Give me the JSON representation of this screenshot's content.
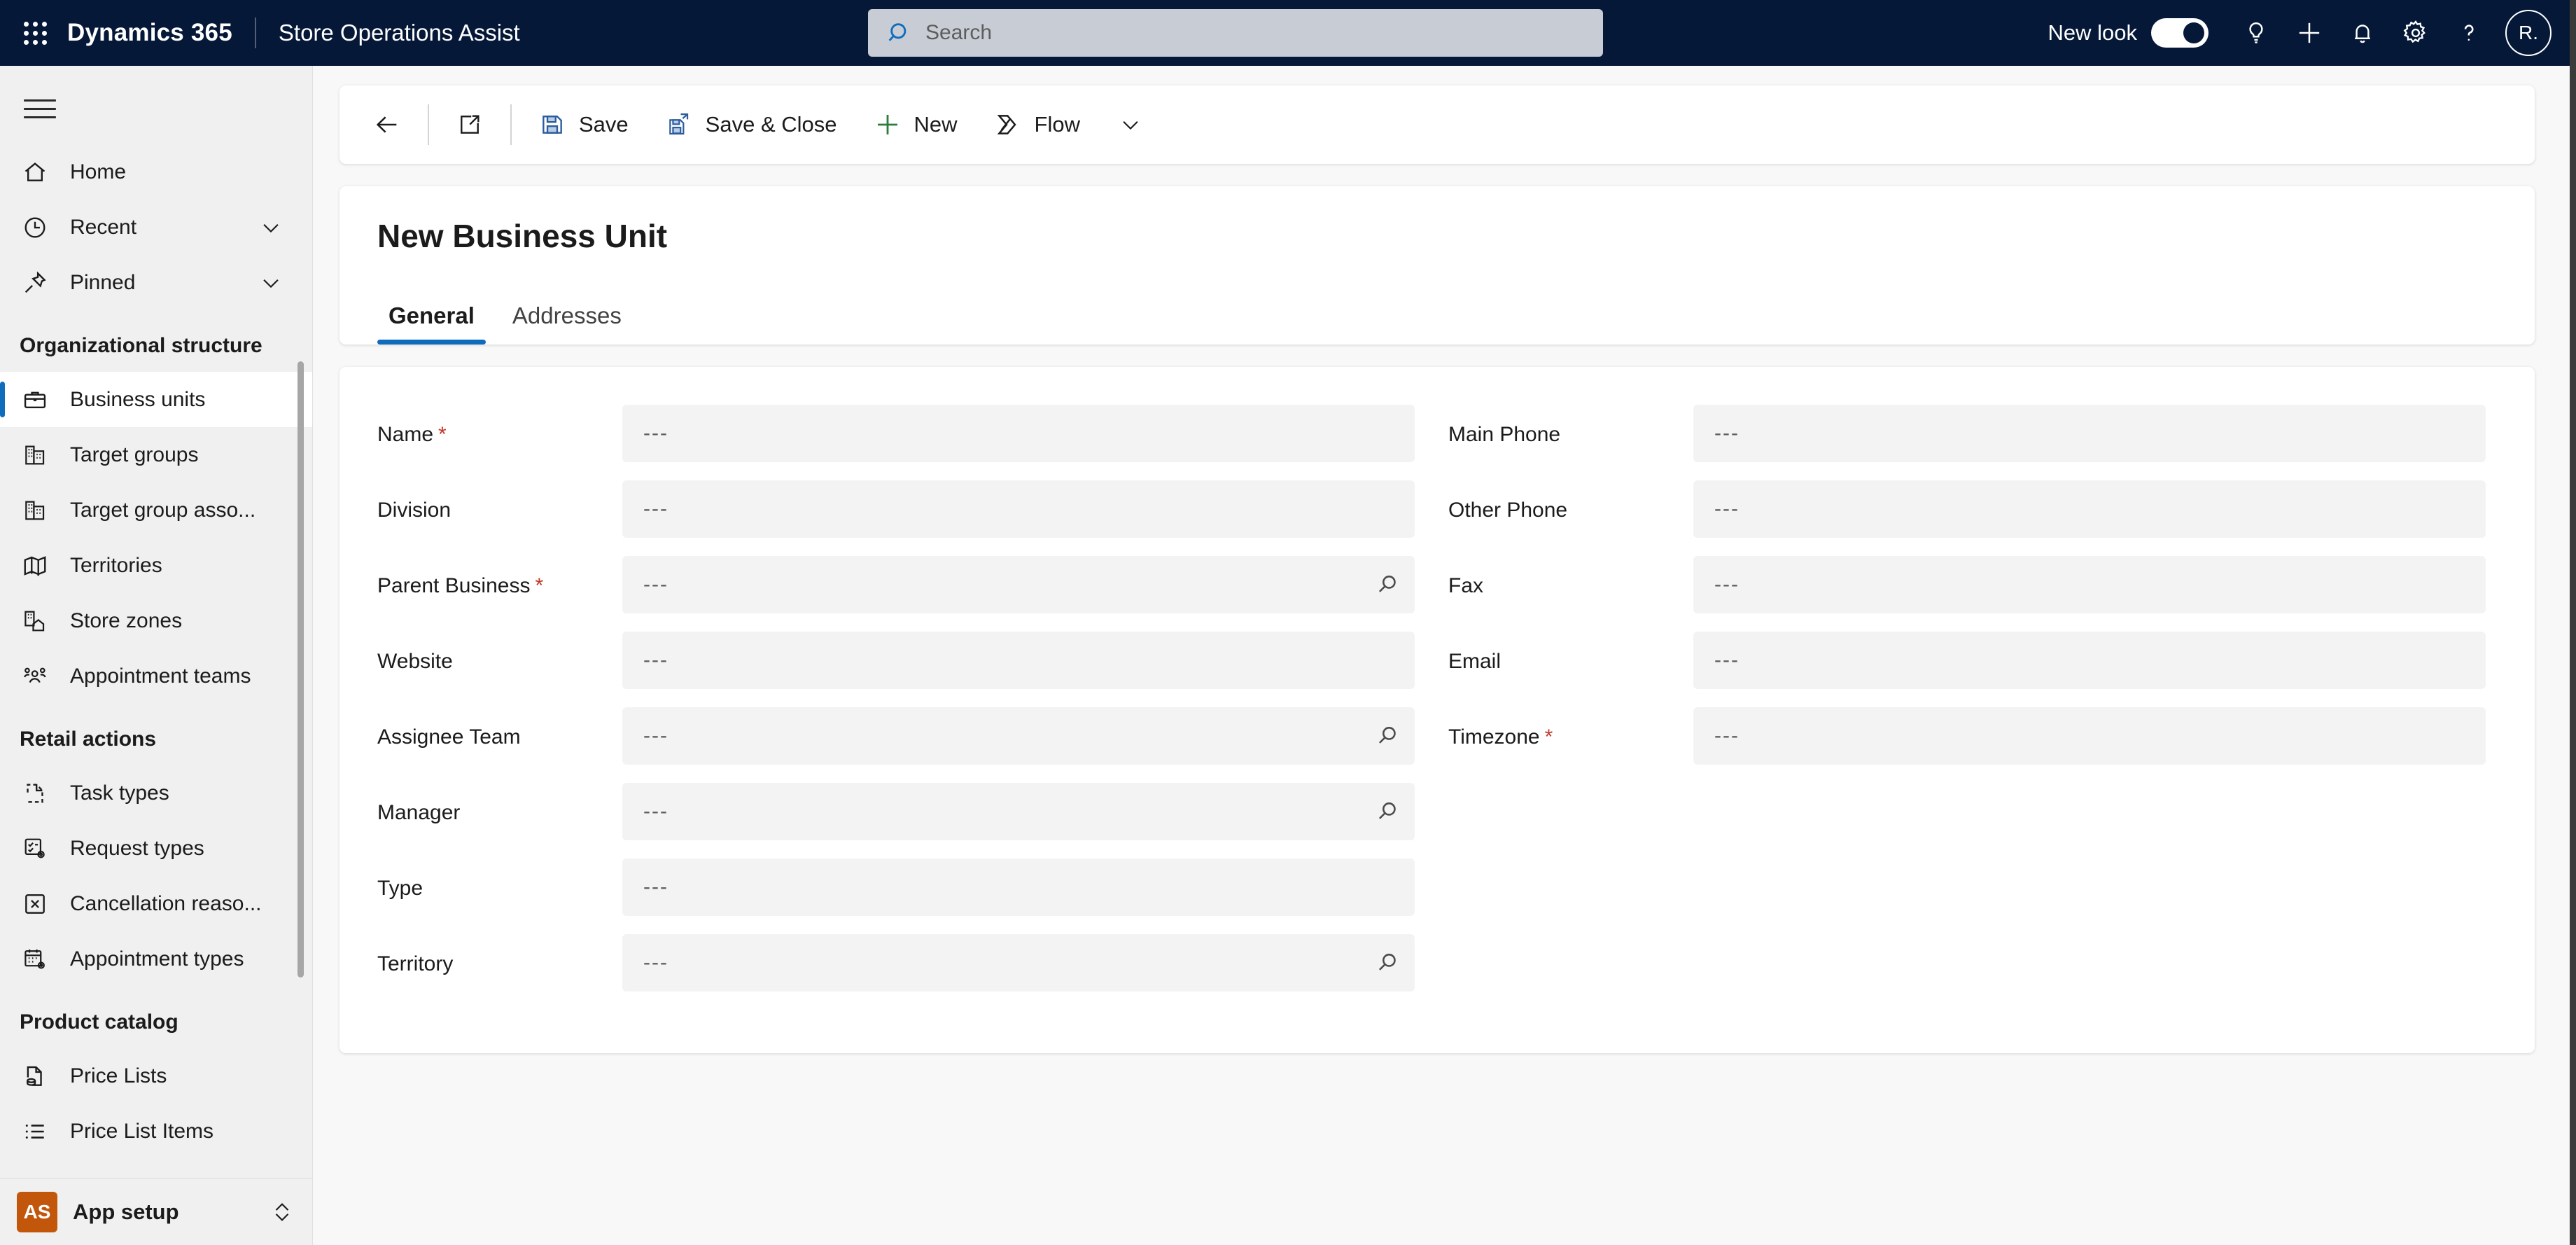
{
  "header": {
    "waffle_icon": "app-launcher-waffle-icon",
    "brand": "Dynamics 365",
    "app_name": "Store Operations Assist",
    "search": {
      "placeholder": "Search",
      "icon": "search-icon"
    },
    "new_look_label": "New look",
    "new_look_on": true,
    "icons": [
      "lightbulb-icon",
      "plus-icon",
      "bell-icon",
      "gear-icon",
      "question-icon"
    ],
    "avatar_initials": "R."
  },
  "sidebar": {
    "hamburger_icon": "hamburger-menu-icon",
    "items": [
      {
        "label": "Home",
        "icon": "home-icon",
        "chevron": false,
        "selected": false
      },
      {
        "label": "Recent",
        "icon": "clock-icon",
        "chevron": true,
        "selected": false
      },
      {
        "label": "Pinned",
        "icon": "pin-icon",
        "chevron": true,
        "selected": false
      }
    ],
    "groups": [
      {
        "title": "Organizational structure",
        "items": [
          {
            "label": "Business units",
            "icon": "briefcase-icon",
            "selected": true
          },
          {
            "label": "Target groups",
            "icon": "building-icon",
            "selected": false
          },
          {
            "label": "Target group asso...",
            "icon": "building-icon",
            "selected": false
          },
          {
            "label": "Territories",
            "icon": "map-icon",
            "selected": false
          },
          {
            "label": "Store zones",
            "icon": "store-zone-icon",
            "selected": false
          },
          {
            "label": "Appointment teams",
            "icon": "people-icon",
            "selected": false
          }
        ]
      },
      {
        "title": "Retail actions",
        "items": [
          {
            "label": "Task types",
            "icon": "document-dashed-icon",
            "selected": false
          },
          {
            "label": "Request types",
            "icon": "checklist-gear-icon",
            "selected": false
          },
          {
            "label": "Cancellation reaso...",
            "icon": "box-x-icon",
            "selected": false
          },
          {
            "label": "Appointment types",
            "icon": "calendar-gear-icon",
            "selected": false
          }
        ]
      },
      {
        "title": "Product catalog",
        "items": [
          {
            "label": "Price Lists",
            "icon": "price-list-icon",
            "selected": false
          },
          {
            "label": "Price List Items",
            "icon": "list-icon",
            "selected": false
          }
        ]
      }
    ],
    "app_setup": {
      "badge": "AS",
      "label": "App setup",
      "chevron_icon": "chevron-up-down-icon"
    }
  },
  "command_bar": {
    "back_icon": "back-arrow-icon",
    "popout_icon": "open-in-new-window-icon",
    "buttons": [
      {
        "label": "Save",
        "icon": "save-icon"
      },
      {
        "label": "Save & Close",
        "icon": "save-and-close-icon"
      },
      {
        "label": "New",
        "icon": "plus-icon"
      },
      {
        "label": "Flow",
        "icon": "flow-icon"
      }
    ],
    "overflow_icon": "chevron-down-icon"
  },
  "record": {
    "title": "New Business Unit",
    "tabs": [
      {
        "label": "General",
        "active": true
      },
      {
        "label": "Addresses",
        "active": false
      }
    ]
  },
  "form": {
    "left_column": [
      {
        "label": "Name",
        "required": true,
        "value": "---",
        "lookup": false
      },
      {
        "label": "Division",
        "required": false,
        "value": "---",
        "lookup": false
      },
      {
        "label": "Parent Business",
        "required": true,
        "value": "---",
        "lookup": true
      },
      {
        "label": "Website",
        "required": false,
        "value": "---",
        "lookup": false
      },
      {
        "label": "Assignee Team",
        "required": false,
        "value": "---",
        "lookup": true
      },
      {
        "label": "Manager",
        "required": false,
        "value": "---",
        "lookup": true
      },
      {
        "label": "Type",
        "required": false,
        "value": "---",
        "lookup": false
      },
      {
        "label": "Territory",
        "required": false,
        "value": "---",
        "lookup": true
      }
    ],
    "right_column": [
      {
        "label": "Main Phone",
        "required": false,
        "value": "---",
        "lookup": false
      },
      {
        "label": "Other Phone",
        "required": false,
        "value": "---",
        "lookup": false
      },
      {
        "label": "Fax",
        "required": false,
        "value": "---",
        "lookup": false
      },
      {
        "label": "Email",
        "required": false,
        "value": "---",
        "lookup": false
      },
      {
        "label": "Timezone",
        "required": true,
        "value": "---",
        "lookup": false
      }
    ]
  },
  "colors": {
    "header_bg": "#061838",
    "accent_blue": "#0f6cbd",
    "required_red": "#c0392b",
    "app_setup_orange": "#c2570c",
    "field_bg": "#f3f3f3",
    "canvas_bg": "#f8f8f8",
    "sidebar_bg": "#f0f0f0"
  }
}
